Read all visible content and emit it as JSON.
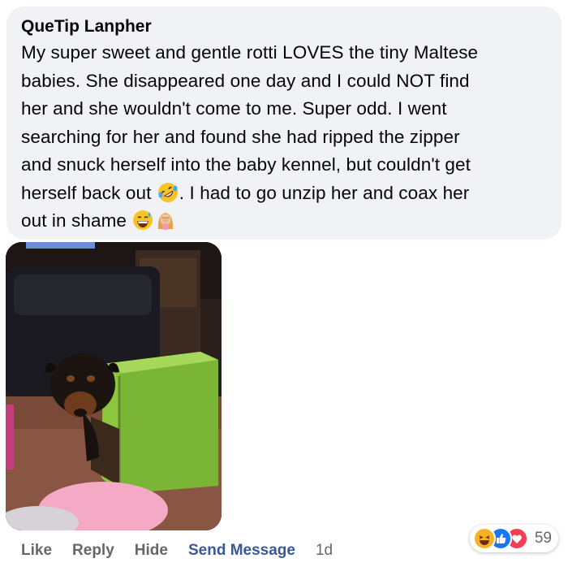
{
  "comment": {
    "author": "QueTip Lanpher",
    "lines": [
      "My super sweet and gentle rotti LOVES the tiny Maltese",
      "babies. She disappeared one day and I could NOT find",
      "her and she wouldn't come to me. Super odd. I went",
      "searching for her and found she had ripped the zipper",
      "and snuck herself into the baby kennel, but couldn't get"
    ],
    "line6_before_emoji": "herself back out ",
    "line6_after_emoji": ". I had to go unzip her and coax her",
    "line7": "out in shame ",
    "emojis": [
      "rolling-on-floor-laughing-icon",
      "grinning-sweat-icon",
      "woman-facepalming-icon"
    ]
  },
  "actions": {
    "like": "Like",
    "reply": "Reply",
    "hide": "Hide",
    "send_message": "Send Message",
    "time": "1d"
  },
  "reactions": {
    "icons": [
      "haha-icon",
      "like-icon",
      "love-icon"
    ],
    "count": "59"
  },
  "colors": {
    "bubble_bg": "#f0f2f5",
    "text": "#050505",
    "muted": "#65676b",
    "link": "#385898",
    "like_blue": "#1877f2",
    "love_red": "#f33e58",
    "haha_yellow": "#f7b125"
  }
}
